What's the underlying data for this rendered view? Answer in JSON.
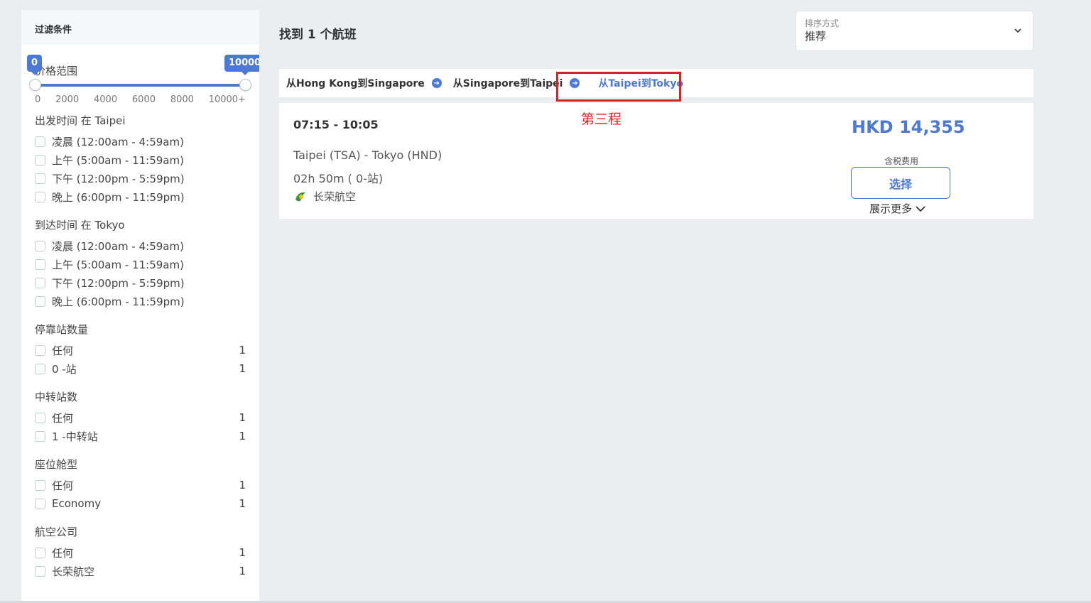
{
  "sidebar": {
    "header": "过滤条件",
    "price": {
      "label": "价格范围",
      "min_value": "0",
      "max_value": "10000",
      "ticks": [
        "0",
        "2000",
        "4000",
        "6000",
        "8000",
        "10000+"
      ]
    },
    "departure": {
      "title": "出发时间 在 Taipei",
      "options": [
        "凌晨 (12:00am - 4:59am)",
        "上午 (5:00am - 11:59am)",
        "下午 (12:00pm - 5:59pm)",
        "晚上 (6:00pm - 11:59pm)"
      ]
    },
    "arrival": {
      "title": "到达时间 在 Tokyo",
      "options": [
        "凌晨 (12:00am - 4:59am)",
        "上午 (5:00am - 11:59am)",
        "下午 (12:00pm - 5:59pm)",
        "晚上 (6:00pm - 11:59pm)"
      ]
    },
    "stops": {
      "title": "停靠站数量",
      "options": [
        {
          "label": "任何",
          "count": "1"
        },
        {
          "label": "0 -站",
          "count": "1"
        }
      ]
    },
    "transfers": {
      "title": "中转站数",
      "options": [
        {
          "label": "任何",
          "count": "1"
        },
        {
          "label": "1 -中转站",
          "count": "1"
        }
      ]
    },
    "cabin": {
      "title": "座位舱型",
      "options": [
        {
          "label": "任何",
          "count": "1"
        },
        {
          "label": "Economy",
          "count": "1"
        }
      ]
    },
    "airlines": {
      "title": "航空公司",
      "options": [
        {
          "label": "任何",
          "count": "1"
        },
        {
          "label": "长荣航空",
          "count": "1"
        }
      ]
    }
  },
  "main": {
    "results_title": "找到 1 个航班",
    "sort": {
      "label": "排序方式",
      "value": "推荐"
    },
    "legs": [
      "从Hong Kong到Singapore",
      "从Singapore到Taipei",
      "从Taipei到Tokyo"
    ],
    "annotation": "第三程",
    "flight": {
      "time": "07:15 - 10:05",
      "route": "Taipei (TSA) - Tokyo (HND)",
      "duration": "02h 50m ( 0-站)",
      "airline": "长荣航空",
      "price": "HKD 14,355",
      "tax_note": "含税费用",
      "select_label": "选择",
      "show_more": "展示更多"
    }
  },
  "colors": {
    "accent": "#4d79d6",
    "annotation_red": "#e02020",
    "background": "#ebedf1"
  }
}
